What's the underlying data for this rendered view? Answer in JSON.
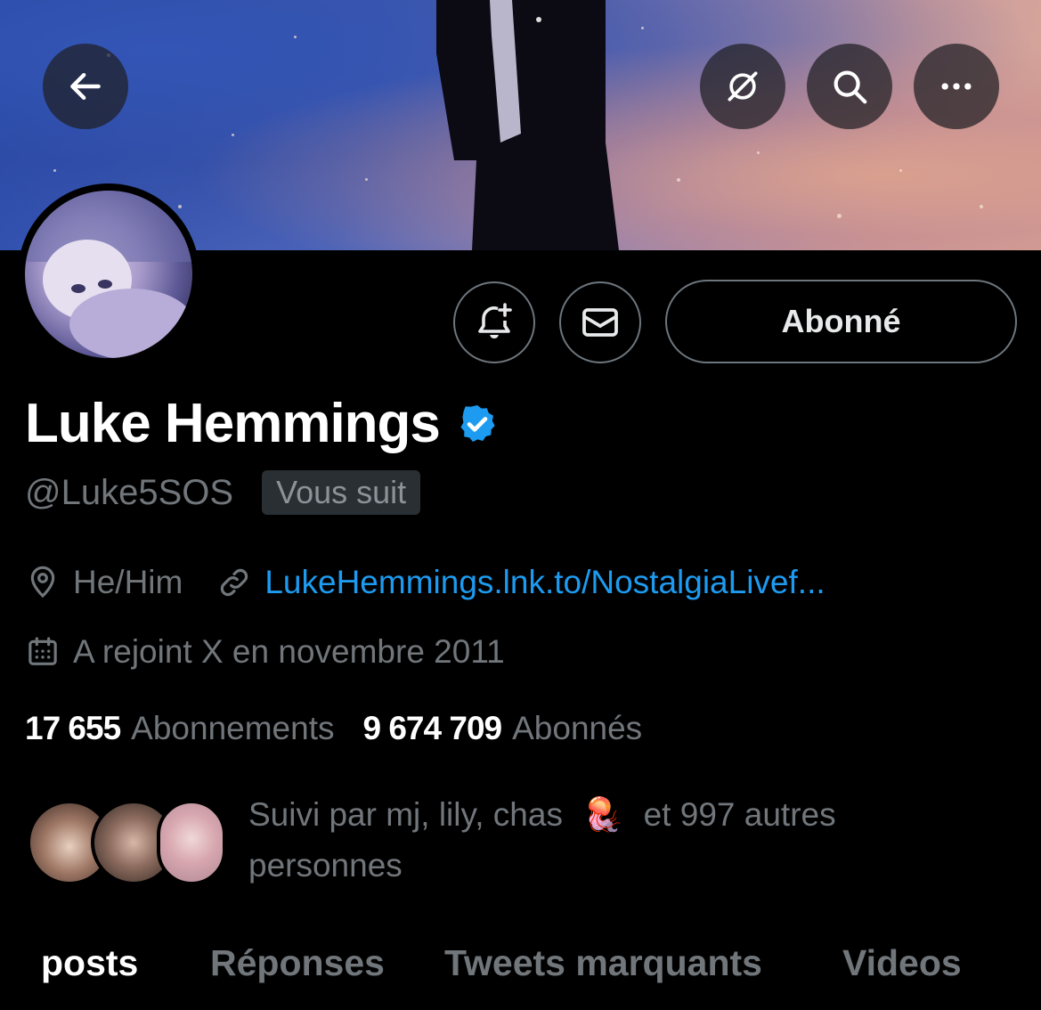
{
  "header": {
    "back_icon": "arrow-left-icon",
    "actions": [
      "no-notifications-icon",
      "search-icon",
      "more-icon"
    ]
  },
  "profile": {
    "name": "Luke Hemmings",
    "verified_icon": "verified-badge-icon",
    "handle": "@Luke5SOS",
    "follows_you": "Vous suit",
    "follow_button": "Abonné",
    "location": "He/Him",
    "website": "LukeHemmings.lnk.to/NostalgiaLivef...",
    "joined": "A rejoint X en novembre 2011"
  },
  "stats": {
    "following_count": "17 655",
    "following_label": "Abonnements",
    "followers_count": "9 674 709",
    "followers_label": "Abonnés"
  },
  "followed_by": {
    "prefix": "Suivi par mj, lily, chas",
    "emoji": "🪼",
    "suffix": "et 997 autres",
    "line2": "personnes"
  },
  "tabs": [
    {
      "label": "posts",
      "active": true
    },
    {
      "label": "Réponses",
      "active": false
    },
    {
      "label": "Tweets marquants",
      "active": false
    },
    {
      "label": "Videos",
      "active": false
    }
  ],
  "colors": {
    "accent": "#1d9bf0",
    "muted": "#71767b",
    "background": "#000000"
  }
}
